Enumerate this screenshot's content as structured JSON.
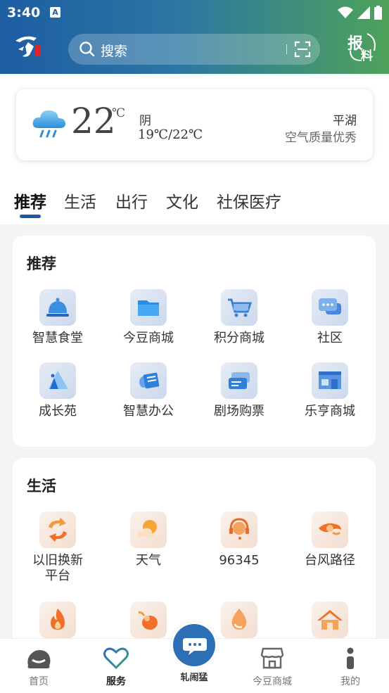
{
  "status_bar": {
    "time": "3:40",
    "notification_letter": "A"
  },
  "header": {
    "search_placeholder": "搜索",
    "report_label_1": "报",
    "report_label_2": "料"
  },
  "weather": {
    "temperature": "22",
    "unit": "℃",
    "condition": "阴",
    "range": "19℃/22℃",
    "location": "平湖",
    "air_quality": "空气质量优秀"
  },
  "tabs": [
    "推荐",
    "生活",
    "出行",
    "文化",
    "社保医疗"
  ],
  "sections": [
    {
      "title": "推荐",
      "items": [
        {
          "label": "智慧食堂",
          "icon": "dining-cloche-icon"
        },
        {
          "label": "今豆商城",
          "icon": "shopping-box-icon"
        },
        {
          "label": "积分商城",
          "icon": "shopping-cart-icon"
        },
        {
          "label": "社区",
          "icon": "chat-bubbles-icon"
        },
        {
          "label": "成长苑",
          "icon": "growth-triangle-icon"
        },
        {
          "label": "智慧办公",
          "icon": "office-document-icon"
        },
        {
          "label": "剧场购票",
          "icon": "ticket-icon"
        },
        {
          "label": "乐亨商城",
          "icon": "storefront-icon"
        }
      ]
    },
    {
      "title": "生活",
      "items": [
        {
          "label": "以旧换新平台",
          "icon": "exchange-arrows-icon"
        },
        {
          "label": "天气",
          "icon": "sun-cloud-icon"
        },
        {
          "label": "96345",
          "icon": "hotline-headset-icon"
        },
        {
          "label": "台风路径",
          "icon": "typhoon-eye-icon"
        },
        {
          "label": "",
          "icon": "flame-icon"
        },
        {
          "label": "",
          "icon": "mouse-icon"
        },
        {
          "label": "",
          "icon": "water-drop-icon"
        },
        {
          "label": "",
          "icon": "house-icon"
        }
      ]
    }
  ],
  "bottom_nav": [
    {
      "label": "首页",
      "icon": "home-face-icon"
    },
    {
      "label": "服务",
      "icon": "heart-icon",
      "active": true
    },
    {
      "label": "轧闹猛",
      "icon": "chat-fab-icon"
    },
    {
      "label": "今豆商城",
      "icon": "shop-icon"
    },
    {
      "label": "我的",
      "icon": "info-person-icon"
    }
  ],
  "colors": {
    "brand_blue": "#1d5da3",
    "brand_green": "#4ea25a",
    "tab_indicator": "#1f58a6"
  }
}
